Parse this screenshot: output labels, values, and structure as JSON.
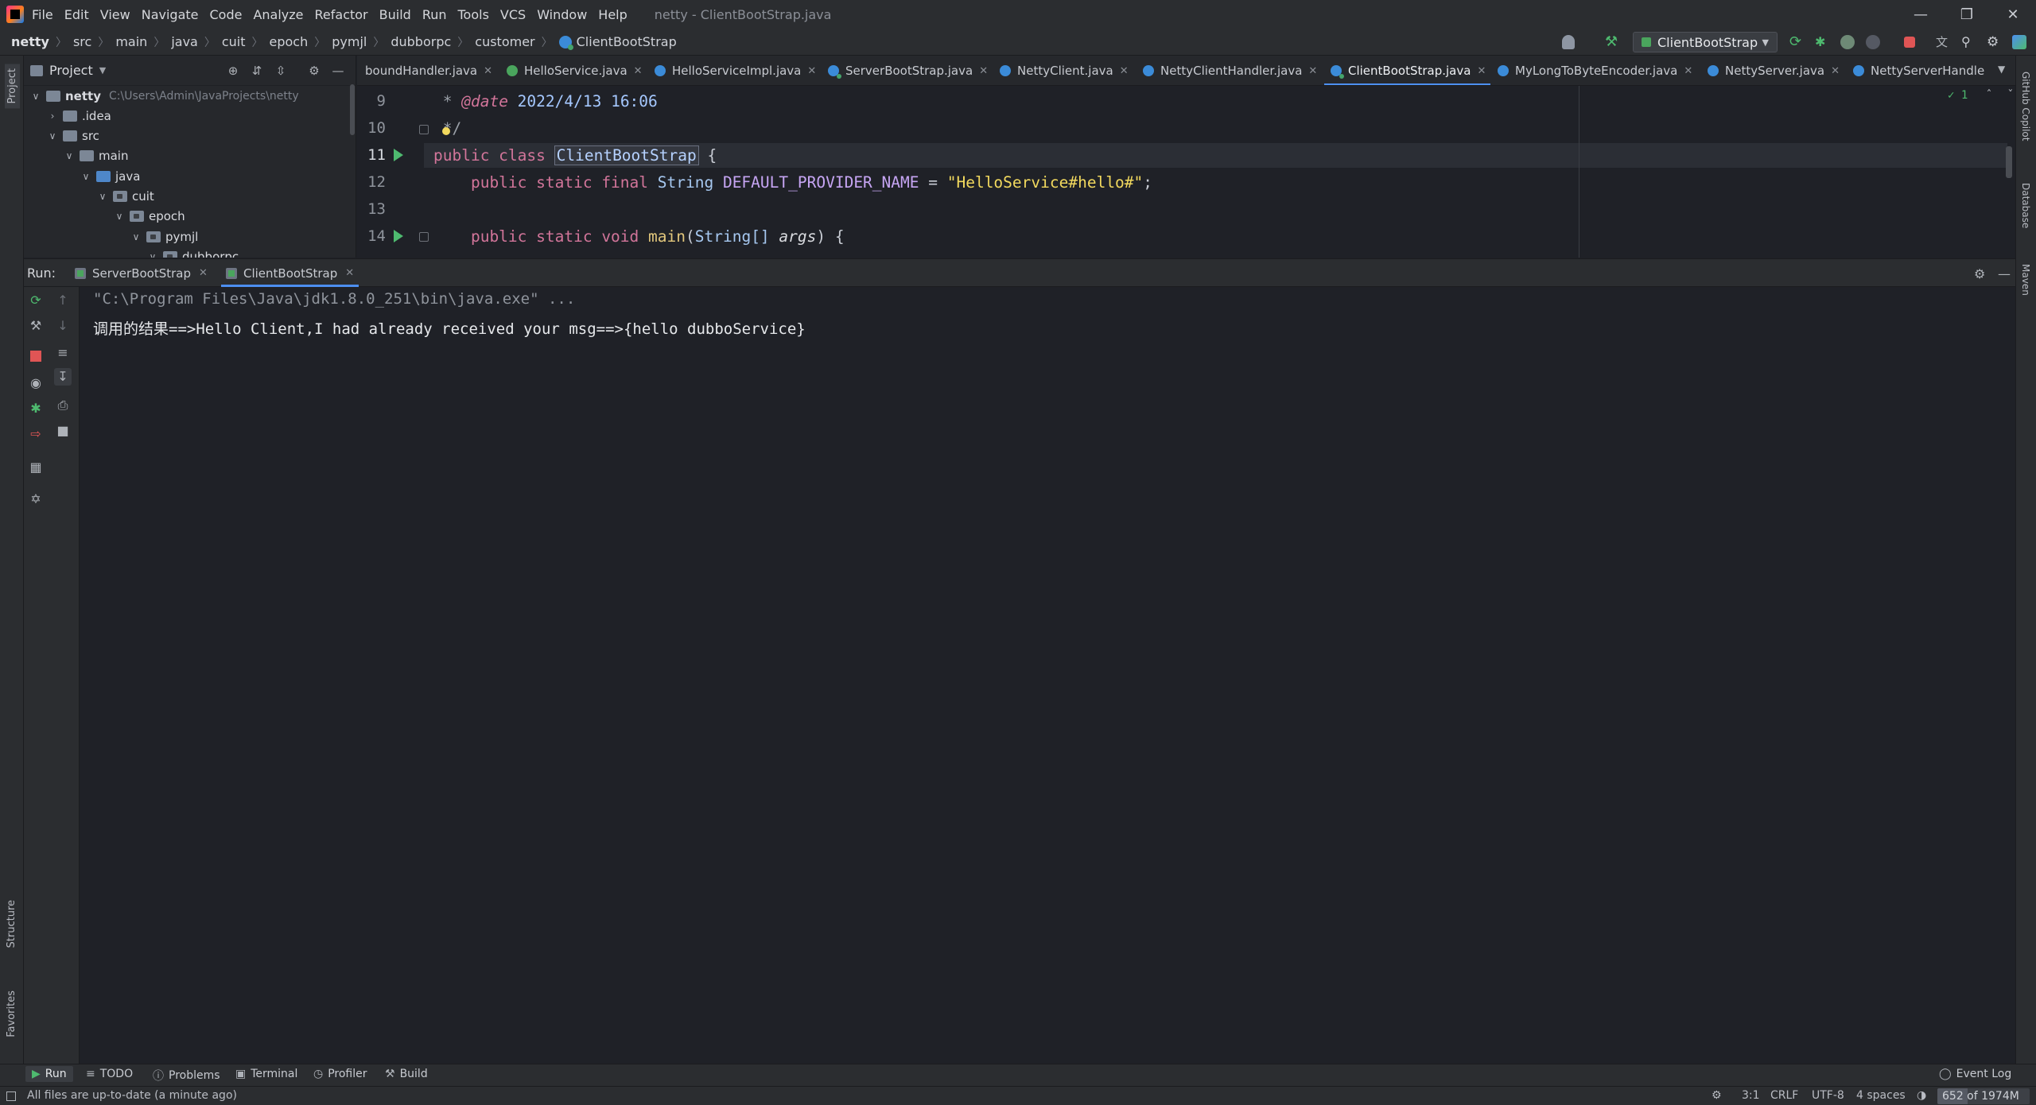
{
  "titlebar": {
    "menu": [
      "File",
      "Edit",
      "View",
      "Navigate",
      "Code",
      "Analyze",
      "Refactor",
      "Build",
      "Run",
      "Tools",
      "VCS",
      "Window",
      "Help"
    ],
    "title": "netty - ClientBootStrap.java"
  },
  "breadcrumb": [
    "netty",
    "src",
    "main",
    "java",
    "cuit",
    "epoch",
    "pymjl",
    "dubborpc",
    "customer",
    "ClientBootStrap"
  ],
  "toolbar": {
    "run_config": "ClientBootStrap"
  },
  "left_stripe": {
    "project": "Project",
    "structure": "Structure",
    "favorites": "Favorites"
  },
  "right_stripe": {
    "copilot": "GitHub Copilot",
    "database": "Database",
    "maven": "Maven"
  },
  "project": {
    "title": "Project",
    "tree": [
      {
        "label": "netty",
        "path": "C:\\Users\\Admin\\JavaProjects\\netty",
        "depth": 0,
        "expanded": true,
        "type": "module"
      },
      {
        "label": ".idea",
        "depth": 1,
        "expanded": false,
        "type": "folder"
      },
      {
        "label": "src",
        "depth": 1,
        "expanded": true,
        "type": "folder"
      },
      {
        "label": "main",
        "depth": 2,
        "expanded": true,
        "type": "folder"
      },
      {
        "label": "java",
        "depth": 3,
        "expanded": true,
        "type": "source"
      },
      {
        "label": "cuit",
        "depth": 4,
        "expanded": true,
        "type": "package"
      },
      {
        "label": "epoch",
        "depth": 5,
        "expanded": true,
        "type": "package"
      },
      {
        "label": "pymjl",
        "depth": 6,
        "expanded": true,
        "type": "package"
      },
      {
        "label": "dubborpc",
        "depth": 7,
        "expanded": true,
        "type": "package"
      }
    ]
  },
  "editor": {
    "tabs": [
      {
        "label": "boundHandler.java",
        "icon": "class"
      },
      {
        "label": "HelloService.java",
        "icon": "interface"
      },
      {
        "label": "HelloServiceImpl.java",
        "icon": "class"
      },
      {
        "label": "ServerBootStrap.java",
        "icon": "runnable-class"
      },
      {
        "label": "NettyClient.java",
        "icon": "class"
      },
      {
        "label": "NettyClientHandler.java",
        "icon": "class"
      },
      {
        "label": "ClientBootStrap.java",
        "icon": "runnable-class",
        "active": true
      },
      {
        "label": "MyLongToByteEncoder.java",
        "icon": "class"
      },
      {
        "label": "NettyServer.java",
        "icon": "class"
      },
      {
        "label": "NettyServerHandle",
        "icon": "class"
      }
    ],
    "line_numbers": [
      "9",
      "10",
      "11",
      "12",
      "13",
      "14"
    ],
    "code": {
      "l9_star": " * ",
      "l9_tag": "@date",
      "l9_rest": " 2022/4/13 16:06",
      "l10": " */",
      "l11_kw": "public class ",
      "l11_name": "ClientBootStrap",
      "l11_brace": " {",
      "l12_kw": "    public static final ",
      "l12_type": "String ",
      "l12_field": "DEFAULT_PROVIDER_NAME",
      "l12_eq": " = ",
      "l12_str": "\"HelloService#hello#\"",
      "l12_end": ";",
      "l14_kw": "    public static void ",
      "l14_method": "main",
      "l14_open": "(",
      "l14_type": "String[] ",
      "l14_param": "args",
      "l14_close": ") {"
    },
    "inspection_count": "1"
  },
  "run": {
    "label": "Run:",
    "tabs": [
      "ServerBootStrap",
      "ClientBootStrap"
    ],
    "console": [
      "\"C:\\Program Files\\Java\\jdk1.8.0_251\\bin\\java.exe\" ...",
      "调用的结果==>Hello Client,I had already received your msg==>{hello dubboService}"
    ]
  },
  "bottom_tabs": [
    "Run",
    "TODO",
    "Problems",
    "Terminal",
    "Profiler",
    "Build"
  ],
  "event_log": "Event Log",
  "status": {
    "message": "All files are up-to-date (a minute ago)",
    "position": "3:1",
    "line_sep": "CRLF",
    "encoding": "UTF-8",
    "indent": "4 spaces",
    "memory": "652 of 1974M",
    "memory_used_fraction": 0.33
  },
  "colors": {
    "accent": "#4d8ff0",
    "run_green": "#4eba6f",
    "stop_red": "#e05555"
  }
}
